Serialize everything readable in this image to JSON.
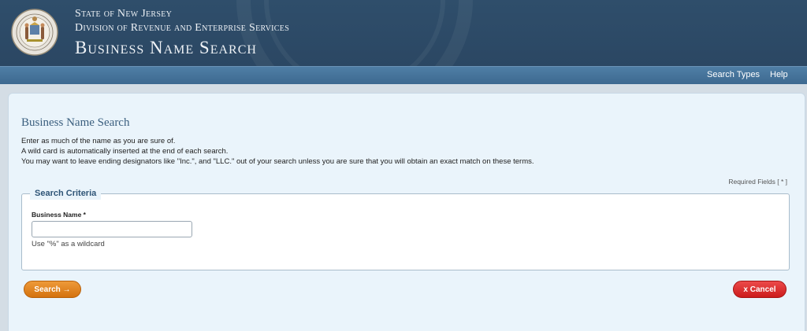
{
  "header": {
    "state": "State of New Jersey",
    "division": "Division of Revenue and Enterprise Services",
    "title": "Business Name Search"
  },
  "nav": {
    "search_types": "Search Types",
    "help": "Help"
  },
  "main": {
    "heading": "Business Name Search",
    "instructions": [
      "Enter as much of the name as you are sure of.",
      "A wild card is automatically inserted at the end of each search.",
      "You may want to leave ending designators like \"Inc.\", and \"LLC.\" out of your search unless you are sure that you will obtain an exact match on these terms."
    ],
    "required_note": "Required Fields [ * ]",
    "criteria": {
      "legend": "Search Criteria",
      "business_name_label": "Business Name *",
      "business_name_value": "",
      "business_name_hint": "Use \"%\" as a wildcard"
    },
    "buttons": {
      "search": "Search →",
      "cancel": "x Cancel"
    }
  },
  "colors": {
    "header_bg": "#2f4e6b",
    "nav_bg": "#4a789f",
    "content_bg": "#eaf4fb",
    "search_button": "#e0821f",
    "cancel_button": "#dc2a2a"
  },
  "icons": {
    "seal": "state-seal-icon"
  }
}
